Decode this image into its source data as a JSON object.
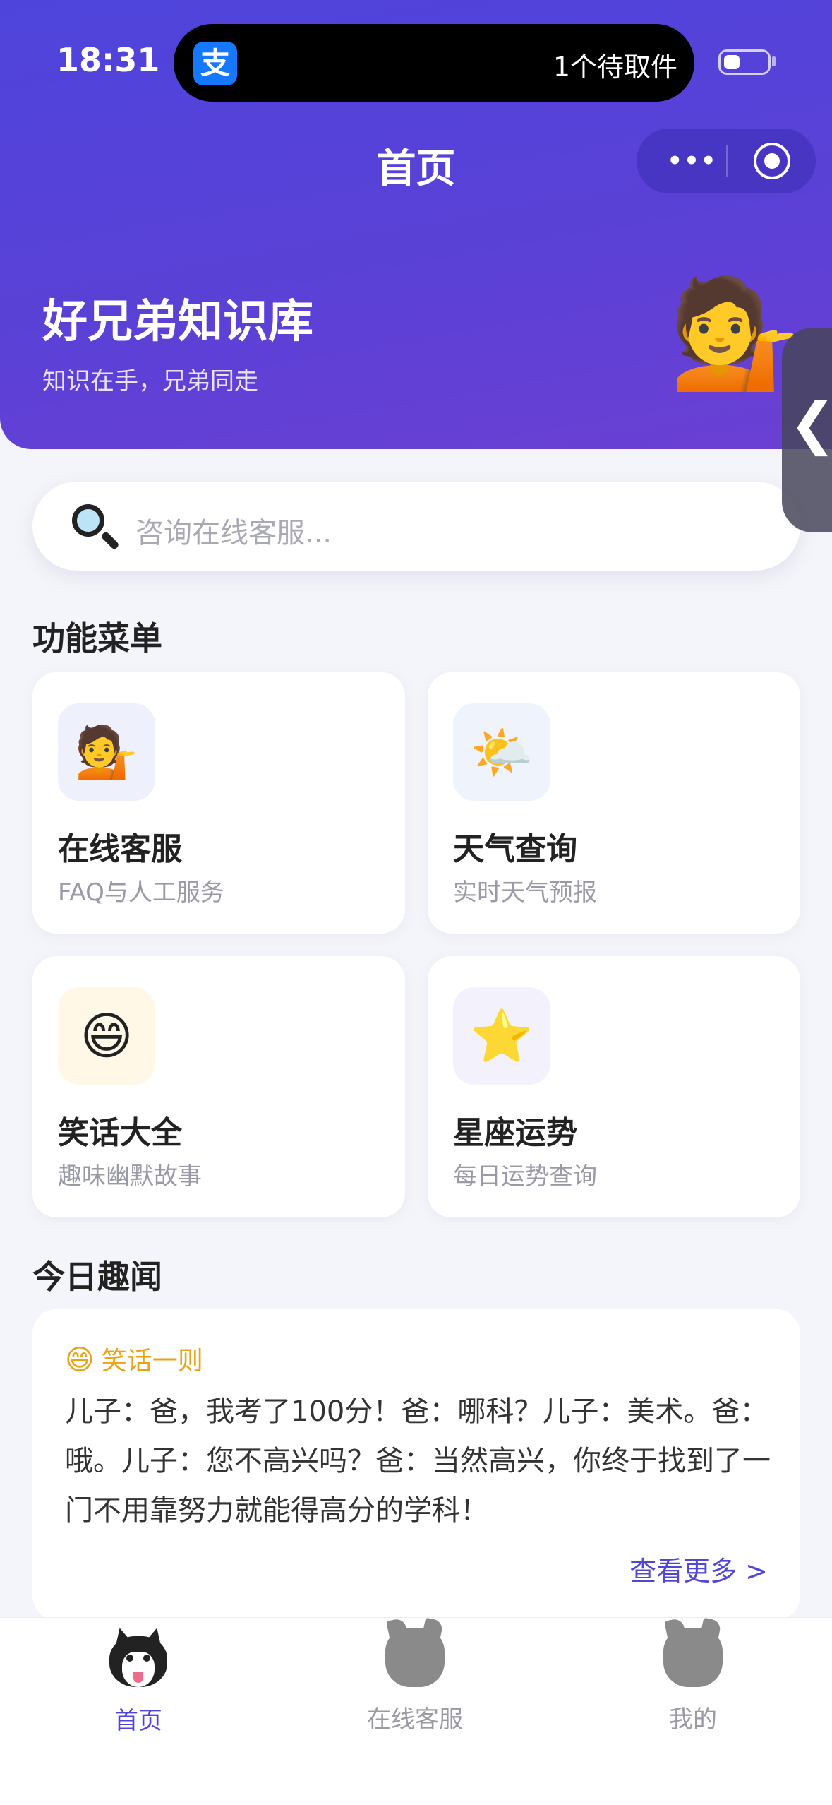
{
  "status_bar": {
    "time": "18:31",
    "island_badge": "支",
    "island_text": "1个待取件"
  },
  "nav": {
    "title": "首页",
    "more_glyph": "•••"
  },
  "hero": {
    "title": "好兄弟知识库",
    "subtitle": "知识在手，兄弟同走",
    "emoji": "💁"
  },
  "side_tab_glyph": "❮",
  "search": {
    "placeholder": "咨询在线客服..."
  },
  "menu": {
    "section_title": "功能菜单",
    "items": [
      {
        "icon": "💁",
        "icon_bg": "#eef0fb",
        "title": "在线客服",
        "subtitle": "FAQ与人工服务"
      },
      {
        "icon": "🌤️",
        "icon_bg": "#eef3fc",
        "title": "天气查询",
        "subtitle": "实时天气预报"
      },
      {
        "icon": "😄",
        "icon_bg": "#fff8e6",
        "title": "笑话大全",
        "subtitle": "趣味幽默故事"
      },
      {
        "icon": "⭐",
        "icon_bg": "#f3f1fb",
        "title": "星座运势",
        "subtitle": "每日运势查询"
      }
    ]
  },
  "today": {
    "section_title": "今日趣闻",
    "tag_emoji": "😄",
    "tag": "笑话一则",
    "body": "儿子：爸，我考了100分！爸：哪科？儿子：美术。爸：哦。儿子：您不高兴吗？爸：当然高兴，你终于找到了一门不用靠努力就能得高分的学科！",
    "more": "查看更多 >"
  },
  "tabbar": {
    "items": [
      {
        "label": "首页",
        "active": true
      },
      {
        "label": "在线客服",
        "active": false
      },
      {
        "label": "我的",
        "active": false
      }
    ]
  },
  "colors": {
    "brand": "#4e44dc",
    "accent_tag": "#e8a317",
    "link": "#5147d6"
  }
}
